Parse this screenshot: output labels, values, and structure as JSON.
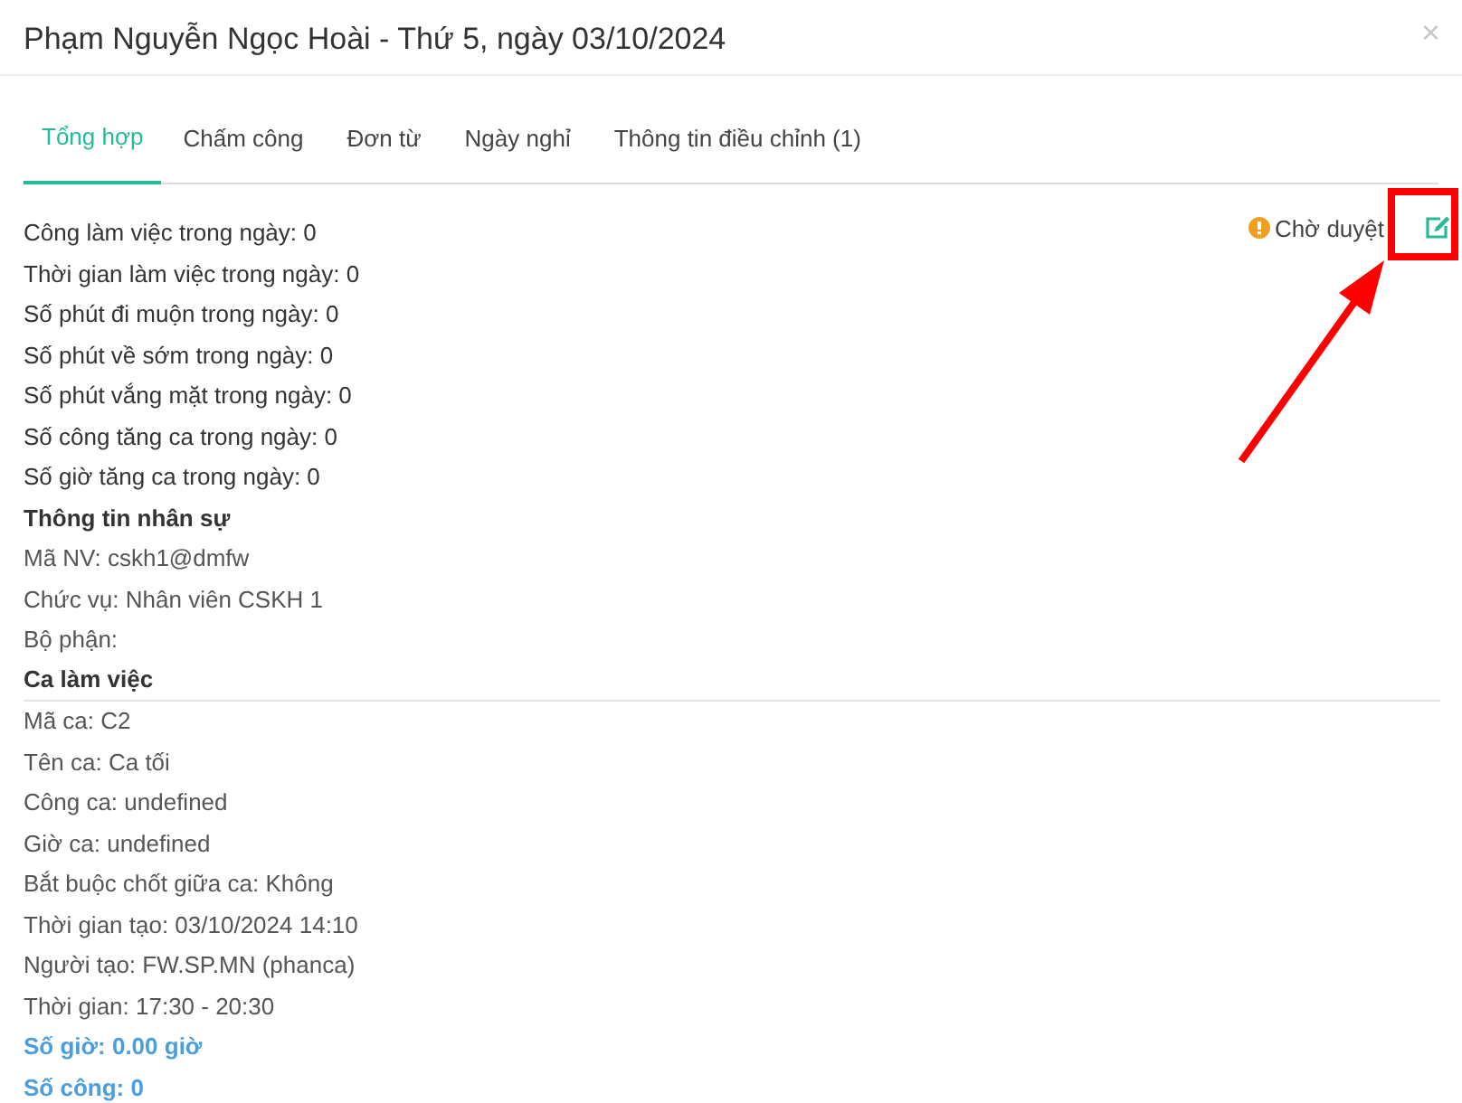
{
  "dialog": {
    "title": "Phạm Nguyễn Ngọc Hoài - Thứ 5, ngày 03/10/2024",
    "close": "×"
  },
  "tabs": [
    {
      "label": "Tổng hợp",
      "selected": true
    },
    {
      "label": "Chấm công",
      "selected": false
    },
    {
      "label": "Đơn từ",
      "selected": false
    },
    {
      "label": "Ngày nghỉ",
      "selected": false
    },
    {
      "label": "Thông tin điều chỉnh (1)",
      "selected": false
    }
  ],
  "status": {
    "label": "Chờ duyệt"
  },
  "lines": [
    {
      "kind": "stat",
      "text": "Công làm việc trong ngày: 0"
    },
    {
      "kind": "stat",
      "text": "Thời gian làm việc trong ngày: 0"
    },
    {
      "kind": "stat",
      "text": "Số phút đi muộn trong ngày: 0"
    },
    {
      "kind": "stat",
      "text": "Số phút về sớm trong ngày: 0"
    },
    {
      "kind": "stat",
      "text": "Số phút vắng mặt trong ngày: 0"
    },
    {
      "kind": "stat",
      "text": "Số công tăng ca trong ngày: 0"
    },
    {
      "kind": "stat",
      "text": "Số giờ tăng ca trong ngày: 0"
    },
    {
      "kind": "heading",
      "text": "Thông tin nhân sự"
    },
    {
      "kind": "info",
      "text": "Mã NV: cskh1@dmfw"
    },
    {
      "kind": "info",
      "text": "Chức vụ: Nhân viên CSKH 1"
    },
    {
      "kind": "info",
      "text": "Bộ phận:"
    },
    {
      "kind": "section",
      "text": "Ca làm việc"
    },
    {
      "kind": "info",
      "text": "Mã ca: C2"
    },
    {
      "kind": "info",
      "text": "Tên ca: Ca tối"
    },
    {
      "kind": "info",
      "text": "Công ca: undefined"
    },
    {
      "kind": "info",
      "text": "Giờ ca: undefined"
    },
    {
      "kind": "info",
      "text": "Bắt buộc chốt giữa ca: Không"
    },
    {
      "kind": "info",
      "text": "Thời gian tạo: 03/10/2024 14:10"
    },
    {
      "kind": "info",
      "text": "Người tạo: FW.SP.MN (phanca)"
    },
    {
      "kind": "info",
      "text": "Thời gian: 17:30 - 20:30"
    },
    {
      "kind": "highlight",
      "text": "Số giờ: 0.00 giờ"
    },
    {
      "kind": "highlight",
      "text": "Số công: 0"
    }
  ]
}
